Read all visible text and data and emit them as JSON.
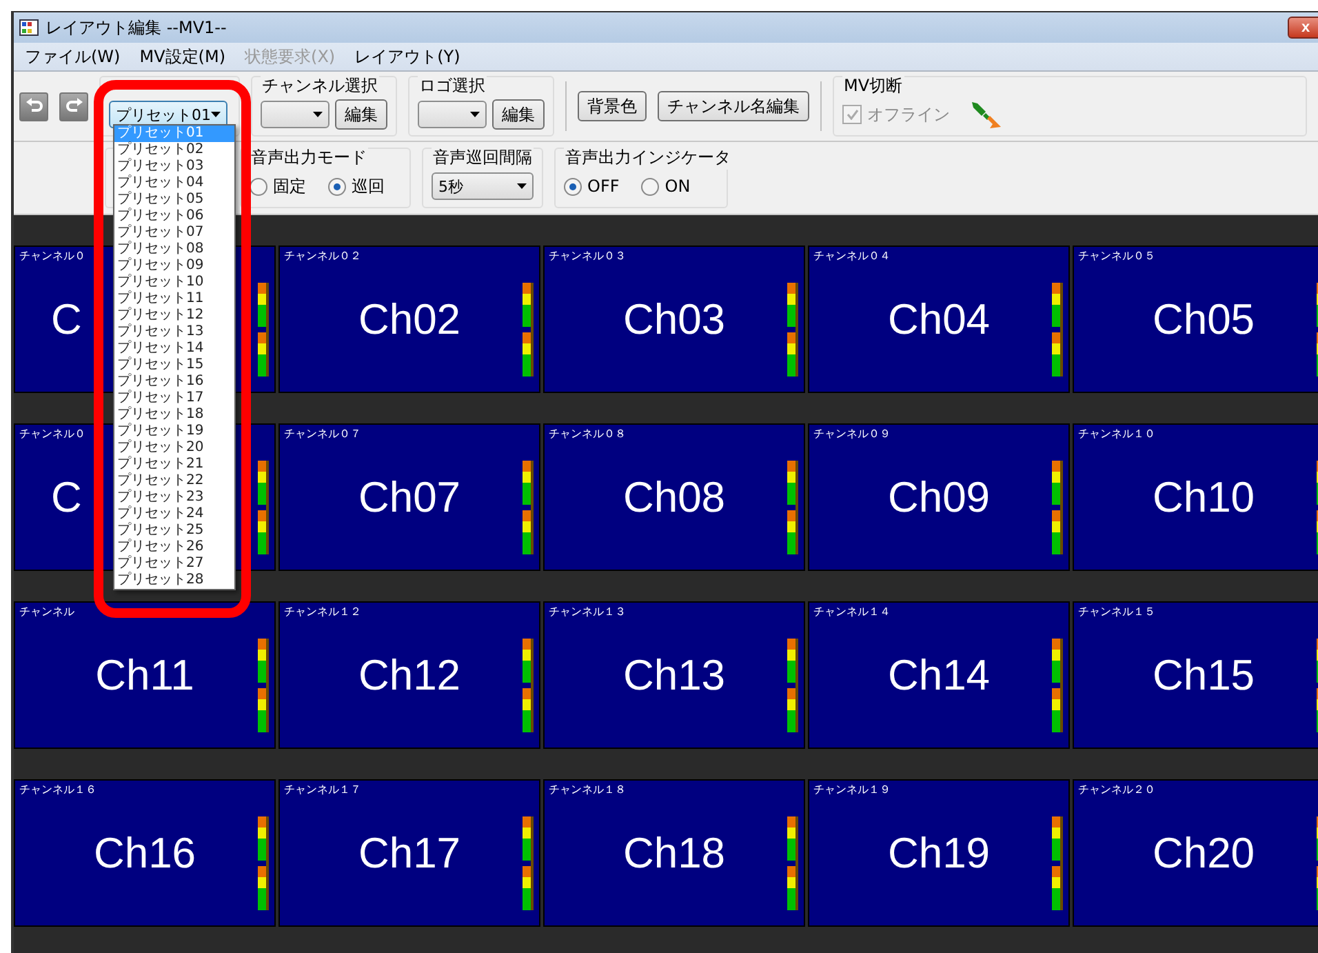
{
  "window": {
    "title": "レイアウト編集 --MV1--",
    "close": "x"
  },
  "menu": [
    {
      "label": "ファイル(W)",
      "disabled": false
    },
    {
      "label": "MV設定(M)",
      "disabled": false
    },
    {
      "label": "状態要求(X)",
      "disabled": true
    },
    {
      "label": "レイアウト(Y)",
      "disabled": false
    }
  ],
  "toolbar": {
    "preset": {
      "value": "プリセット01",
      "expanded": true,
      "options": [
        {
          "label": "プリセット01",
          "selected": true
        },
        {
          "label": "プリセット02",
          "selected": false
        },
        {
          "label": "プリセット03",
          "selected": false
        },
        {
          "label": "プリセット04",
          "selected": false
        },
        {
          "label": "プリセット05",
          "selected": false
        },
        {
          "label": "プリセット06",
          "selected": false
        },
        {
          "label": "プリセット07",
          "selected": false
        },
        {
          "label": "プリセット08",
          "selected": false
        },
        {
          "label": "プリセット09",
          "selected": false
        },
        {
          "label": "プリセット10",
          "selected": false
        },
        {
          "label": "プリセット11",
          "selected": false
        },
        {
          "label": "プリセット12",
          "selected": false
        },
        {
          "label": "プリセット13",
          "selected": false
        },
        {
          "label": "プリセット14",
          "selected": false
        },
        {
          "label": "プリセット15",
          "selected": false
        },
        {
          "label": "プリセット16",
          "selected": false
        },
        {
          "label": "プリセット17",
          "selected": false
        },
        {
          "label": "プリセット18",
          "selected": false
        },
        {
          "label": "プリセット19",
          "selected": false
        },
        {
          "label": "プリセット20",
          "selected": false
        },
        {
          "label": "プリセット21",
          "selected": false
        },
        {
          "label": "プリセット22",
          "selected": false
        },
        {
          "label": "プリセット23",
          "selected": false
        },
        {
          "label": "プリセット24",
          "selected": false
        },
        {
          "label": "プリセット25",
          "selected": false
        },
        {
          "label": "プリセット26",
          "selected": false
        },
        {
          "label": "プリセット27",
          "selected": false
        },
        {
          "label": "プリセット28",
          "selected": false
        }
      ]
    },
    "selectors": [
      {
        "title": "チャンネル選択",
        "button": "編集"
      },
      {
        "title": "ロゴ選択",
        "button": "編集"
      }
    ],
    "buttons": [
      "背景色",
      "チャンネル名編集"
    ],
    "mv_disconnect": {
      "title": "MV切断",
      "label": "オフライン",
      "checked": true,
      "disabled": true
    }
  },
  "toolbar2": {
    "audio_mode": {
      "title": "音声出力モード",
      "options": [
        {
          "label": "固定",
          "selected": false
        },
        {
          "label": "巡回",
          "selected": true
        }
      ]
    },
    "audio_interval": {
      "title": "音声巡回間隔",
      "value": "5秒"
    },
    "audio_indicator": {
      "title": "音声出力インジケータ",
      "options": [
        {
          "label": "OFF",
          "selected": true
        },
        {
          "label": "ON",
          "selected": false
        }
      ]
    }
  },
  "tiles": [
    {
      "label": "チャンネル０",
      "name": "C",
      "kind": "partial"
    },
    {
      "label": "チャンネル０２",
      "name": "Ch02"
    },
    {
      "label": "チャンネル０３",
      "name": "Ch03"
    },
    {
      "label": "チャンネル０４",
      "name": "Ch04"
    },
    {
      "label": "チャンネル０５",
      "name": "Ch05"
    },
    {
      "label": "チャンネル０",
      "name": "C",
      "kind": "partial"
    },
    {
      "label": "チャンネル０７",
      "name": "Ch07"
    },
    {
      "label": "チャンネル０８",
      "name": "Ch08"
    },
    {
      "label": "チャンネル０９",
      "name": "Ch09"
    },
    {
      "label": "チャンネル１０",
      "name": "Ch10"
    },
    {
      "label": "チャンネル",
      "name": "Ch11"
    },
    {
      "label": "チャンネル１２",
      "name": "Ch12"
    },
    {
      "label": "チャンネル１３",
      "name": "Ch13"
    },
    {
      "label": "チャンネル１４",
      "name": "Ch14"
    },
    {
      "label": "チャンネル１５",
      "name": "Ch15"
    },
    {
      "label": "チャンネル１６",
      "name": "Ch16"
    },
    {
      "label": "チャンネル１７",
      "name": "Ch17"
    },
    {
      "label": "チャンネル１８",
      "name": "Ch18"
    },
    {
      "label": "チャンネル１９",
      "name": "Ch19"
    },
    {
      "label": "チャンネル２０",
      "name": "Ch20"
    }
  ]
}
